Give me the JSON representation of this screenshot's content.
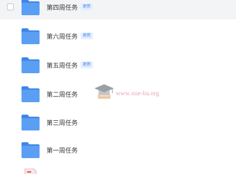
{
  "files": [
    {
      "name": "第四周任务",
      "badge": "更新"
    },
    {
      "name": "第六周任务",
      "badge": "更新"
    },
    {
      "name": "第五周任务",
      "badge": "更新"
    },
    {
      "name": "第二周任务",
      "badge": ""
    },
    {
      "name": "第三周任务",
      "badge": ""
    },
    {
      "name": "第一周任务",
      "badge": ""
    }
  ],
  "watermark": {
    "text": "www.xue-ba.org"
  },
  "colors": {
    "folder": "#5b9ff5",
    "folder_tab": "#3f86e8",
    "badge_text": "#4a8df0",
    "badge_bg": "#e6efff",
    "row_highlight": "#f3f4f6",
    "watermark_text": "#e6a3ad"
  }
}
